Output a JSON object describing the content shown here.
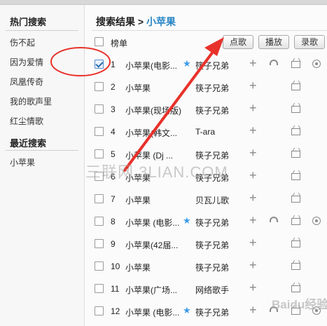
{
  "sidebar": {
    "hot_title": "热门搜索",
    "hot_items": [
      "伤不起",
      "因为爱情",
      "凤凰传奇",
      "我的歌声里",
      "红尘情歌"
    ],
    "recent_title": "最近搜索",
    "recent_items": [
      "小苹果"
    ]
  },
  "main": {
    "results_label": "搜索结果",
    "separator": ">",
    "query": "小苹果",
    "header_label": "榜单",
    "buttons": {
      "request": "点歌",
      "play": "播放",
      "record": "录歌"
    },
    "rows": [
      {
        "num": "1",
        "title": "小苹果(电影...",
        "star": true,
        "artist": "筷子兄弟",
        "headphone": true,
        "play": true,
        "checked": true
      },
      {
        "num": "2",
        "title": "小苹果",
        "star": false,
        "artist": "筷子兄弟",
        "headphone": false,
        "play": false,
        "checked": false
      },
      {
        "num": "3",
        "title": "小苹果(现场版)",
        "star": false,
        "artist": "筷子兄弟",
        "headphone": false,
        "play": false,
        "checked": false
      },
      {
        "num": "4",
        "title": "小苹果(韩文...",
        "star": false,
        "artist": "T-ara",
        "headphone": false,
        "play": false,
        "checked": false
      },
      {
        "num": "5",
        "title": "小苹果 (Dj ...",
        "star": false,
        "artist": "筷子兄弟",
        "headphone": false,
        "play": false,
        "checked": false
      },
      {
        "num": "6",
        "title": "小苹果",
        "star": false,
        "artist": "筷子兄弟",
        "headphone": false,
        "play": false,
        "checked": false
      },
      {
        "num": "7",
        "title": "小苹果",
        "star": false,
        "artist": "贝瓦儿歌",
        "headphone": false,
        "play": false,
        "checked": false
      },
      {
        "num": "8",
        "title": "小苹果 (电影...",
        "star": true,
        "artist": "筷子兄弟",
        "headphone": true,
        "play": true,
        "checked": false
      },
      {
        "num": "9",
        "title": "小苹果(42届...",
        "star": false,
        "artist": "筷子兄弟",
        "headphone": false,
        "play": false,
        "checked": false
      },
      {
        "num": "10",
        "title": "小苹果",
        "star": false,
        "artist": "筷子兄弟",
        "headphone": false,
        "play": false,
        "checked": false
      },
      {
        "num": "11",
        "title": "小苹果(广场...",
        "star": false,
        "artist": "网络歌手",
        "headphone": false,
        "play": false,
        "checked": false
      },
      {
        "num": "12",
        "title": "小苹果 (电影...",
        "star": true,
        "artist": "筷子兄弟",
        "headphone": true,
        "play": true,
        "checked": false
      }
    ]
  },
  "watermarks": {
    "site": "三联网 3LIAN.COM",
    "baidu": "Baidu经验"
  },
  "colors": {
    "accent": "#2a86c5",
    "star": "#3d9be9",
    "annotation": "#e8312a"
  }
}
